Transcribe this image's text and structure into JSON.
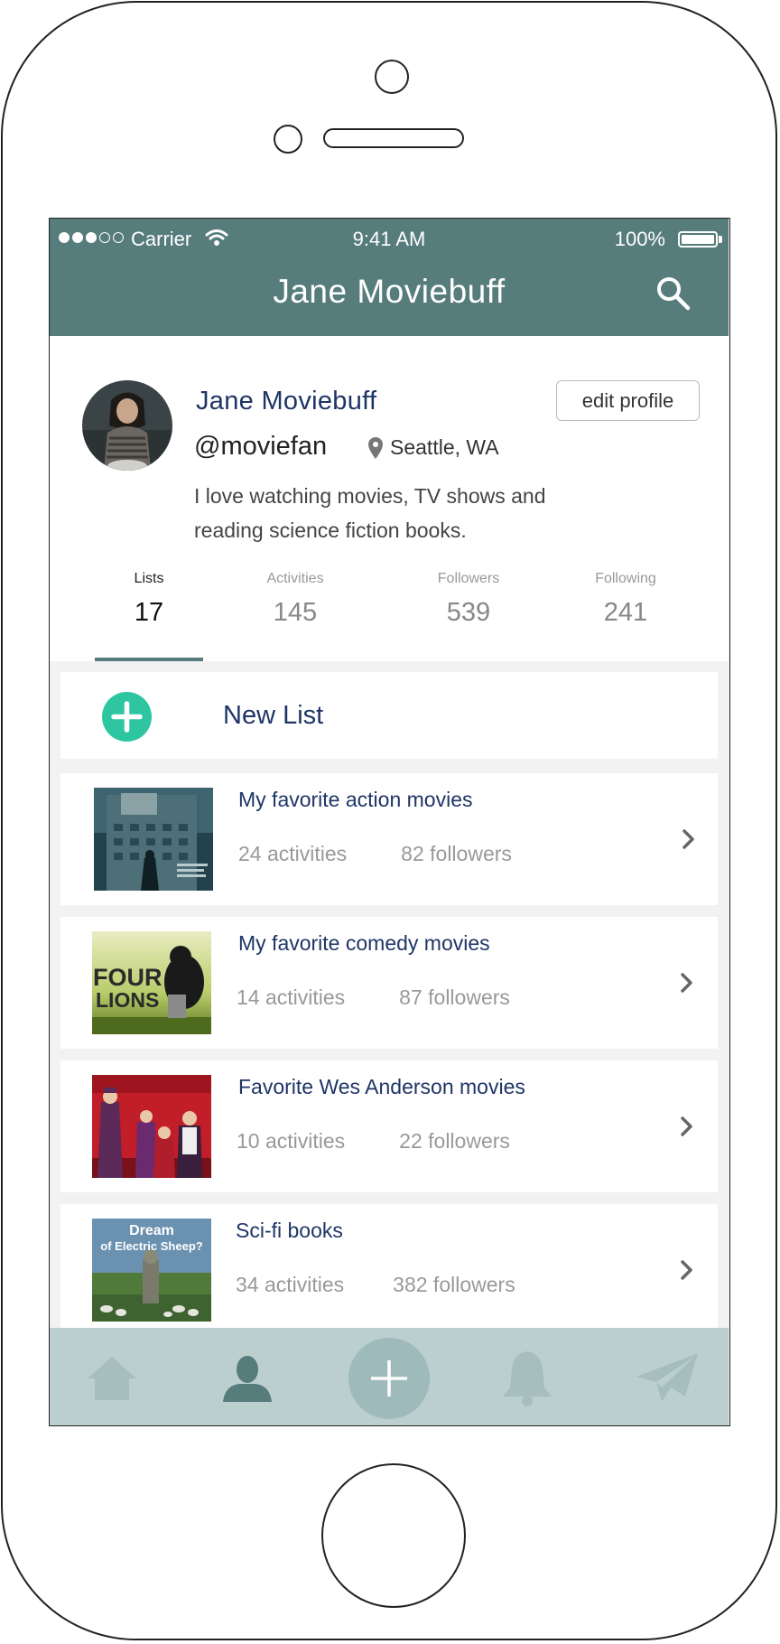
{
  "status_bar": {
    "carrier": "Carrier",
    "time": "9:41 AM",
    "battery": "100%",
    "signal_bars_filled": 3,
    "signal_bars_total": 5
  },
  "header": {
    "title": "Jane Moviebuff",
    "search_icon": "search-icon",
    "background_color": "#577c7c"
  },
  "profile": {
    "name": "Jane Moviebuff",
    "handle": "@moviefan",
    "location": "Seattle, WA",
    "bio_line1": "I love watching movies, TV shows and",
    "bio_line2": "reading science fiction books.",
    "edit_label": "edit profile"
  },
  "stats": [
    {
      "label": "Lists",
      "value": "17",
      "active": true
    },
    {
      "label": "Activities",
      "value": "145",
      "active": false
    },
    {
      "label": "Followers",
      "value": "539",
      "active": false
    },
    {
      "label": "Following",
      "value": "241",
      "active": false
    }
  ],
  "new_list": {
    "label": "New List",
    "accent_color": "#2ec6a1"
  },
  "lists": [
    {
      "title": "My favorite action movies",
      "activities": "24 activities",
      "followers": "82 followers"
    },
    {
      "title": "My favorite comedy movies",
      "activities": "14 activities",
      "followers": "87 followers"
    },
    {
      "title": "Favorite Wes Anderson movies",
      "activities": "10 activities",
      "followers": "22 followers"
    },
    {
      "title": "Sci-fi books",
      "activities": "34 activities",
      "followers": "382 followers"
    }
  ],
  "thumbnails": {
    "comedy_text_1": "FOUR",
    "comedy_text_2": "LIONS",
    "scifi_text_1": "Dream",
    "scifi_text_2": "of Electric Sheep?"
  },
  "tab_bar": {
    "items": [
      "home-icon",
      "profile-icon",
      "add-icon",
      "bell-icon",
      "send-icon"
    ],
    "active": "profile-icon"
  }
}
